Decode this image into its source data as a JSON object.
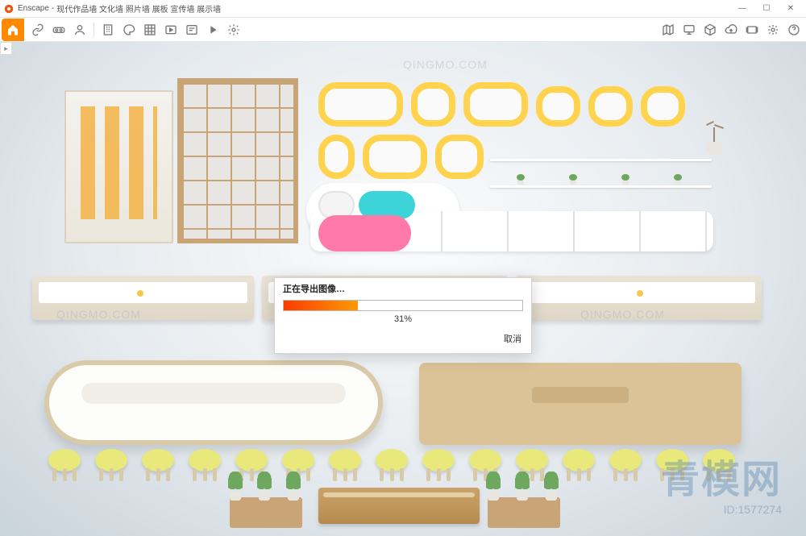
{
  "titlebar": {
    "app_name": "Enscape",
    "document_title": "现代作品墙 文化墙 照片墙 展板 宣传墙 展示墙"
  },
  "window_controls": {
    "minimize": "—",
    "maximize": "☐",
    "close": "✕"
  },
  "toolbar": {
    "left_icons": [
      "home",
      "link",
      "glasses",
      "person",
      "building",
      "palette",
      "spreadsheet",
      "media",
      "settings-panel",
      "play",
      "gear"
    ],
    "right_icons": [
      "map",
      "display",
      "cube",
      "cloud-upload",
      "slides",
      "burst",
      "help"
    ]
  },
  "dialog": {
    "title": "正在导出图像…",
    "progress_percent": 31,
    "percent_label": "31%",
    "cancel_label": "取消"
  },
  "watermarks": {
    "big": "青模网",
    "id": "ID:1577274",
    "small": "QINGMO.COM"
  },
  "scene": {
    "stool_count": 15,
    "stool_spacing_px": 58
  },
  "colors": {
    "accent": "#ff8a00",
    "progress_start": "#ff3a00",
    "progress_end": "#ff9a00",
    "stool_seat": "#e8e97a",
    "yellow_frame": "#ffd34d"
  }
}
